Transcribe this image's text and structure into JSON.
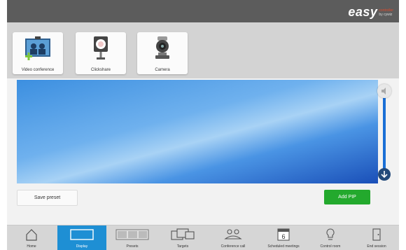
{
  "brand": {
    "name": "easy",
    "line1": "controller",
    "line2": "by cywiz"
  },
  "sources": [
    {
      "label": "Video conference",
      "icon": "video-conference-icon"
    },
    {
      "label": "Clickshare",
      "icon": "clickshare-icon"
    },
    {
      "label": "Camera",
      "icon": "camera-icon"
    }
  ],
  "volume": {
    "level": 0.92
  },
  "actions": {
    "save_preset": "Save preset",
    "add_pip": "Add PIP"
  },
  "nav": {
    "items": [
      {
        "label": "Home",
        "icon": "home-icon"
      },
      {
        "label": "Display",
        "icon": "display-icon",
        "active": true
      },
      {
        "label": "Presets",
        "icon": "presets-icon"
      },
      {
        "label": "Targets",
        "icon": "targets-icon"
      },
      {
        "label": "Conference call",
        "icon": "conference-call-icon"
      },
      {
        "label": "Scheduled meetings",
        "icon": "calendar-icon",
        "badge": "6"
      },
      {
        "label": "Control room",
        "icon": "lightbulb-icon"
      },
      {
        "label": "End session",
        "icon": "door-icon"
      }
    ]
  },
  "colors": {
    "accent": "#1e8fd4",
    "add_button": "#23a92d",
    "topbar": "#5c5c5c"
  }
}
